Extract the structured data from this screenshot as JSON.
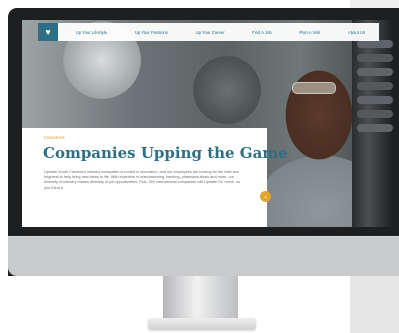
{
  "nav": {
    "logo_icon": "heart-badge-icon",
    "items": [
      {
        "label": "Up Your Lifestyle"
      },
      {
        "label": "Up Your Passions"
      },
      {
        "label": "Up Your Career"
      },
      {
        "label": "Find A Job"
      },
      {
        "label": "Plan A Visit"
      },
      {
        "label": "About Us"
      }
    ]
  },
  "article": {
    "kicker": "Industries",
    "headline": "Companies Upping the Game",
    "body": "Upstate South Carolina's industry ecosystem is rooted in innovation, and our employees are looking for the best and brightest to help bring new ideas to life. With expertise in manufacturing, banking, pharmaceuticals and more, our diversity of industry means diversity of job opportunities. Plus, 500 international companies call Upstate SC home, so you'll find a"
  },
  "scroll_button": {
    "icon": "chevron-down-icon",
    "glyph": "⌄"
  },
  "colors": {
    "brand": "#2f6f86",
    "accent": "#e3a62e",
    "monitor_bezel": "#1e1f21",
    "monitor_chin": "#c9cacc"
  }
}
